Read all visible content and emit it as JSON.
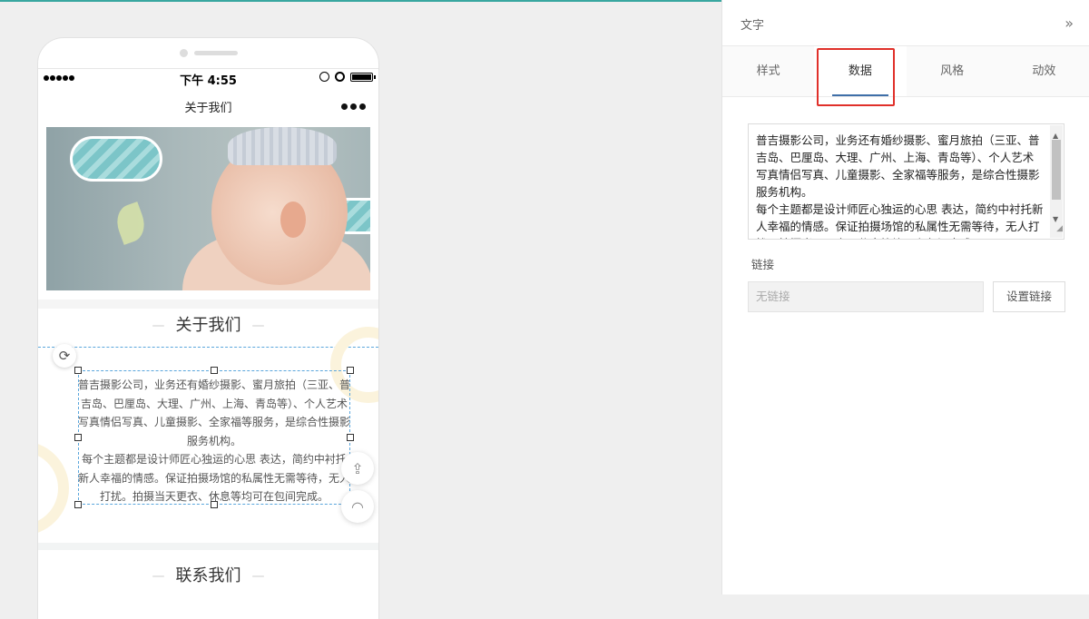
{
  "phone": {
    "status": {
      "time": "下午 4:55"
    },
    "navbar": {
      "title": "关于我们"
    },
    "section1": {
      "heading": "关于我们",
      "dash": "—"
    },
    "about_text": "普吉摄影公司，业务还有婚纱摄影、蜜月旅拍（三亚、普吉岛、巴厘岛、大理、广州、上海、青岛等）、个人艺术写真情侣写真、儿童摄影、全家福等服务，是综合性摄影服务机构。\n每个主题都是设计师匠心独运的心思 表达，简约中衬托新人幸福的情感。保证拍摄场馆的私属性无需等待，无人打扰。拍摄当天更衣、休息等均可在包间完成。",
    "section2": {
      "heading": "联系我们"
    }
  },
  "panel": {
    "title": "文字",
    "tabs": [
      "样式",
      "数据",
      "风格",
      "动效"
    ],
    "active_tab": "数据",
    "textarea_value": "普吉摄影公司，业务还有婚纱摄影、蜜月旅拍（三亚、普吉岛、巴厘岛、大理、广州、上海、青岛等）、个人艺术写真情侣写真、儿童摄影、全家福等服务，是综合性摄影服务机构。\n每个主题都是设计师匠心独运的心思 表达，简约中衬托新人幸福的情感。保证拍摄场馆的私属性无需等待，无人打扰。拍摄当天更衣、休息等均可在包间完成。",
    "link": {
      "label": "链接",
      "value": "无链接",
      "button": "设置链接"
    }
  },
  "colors": {
    "accent": "#3f6fa8",
    "highlight": "#e0302a",
    "selection": "#5aa6dc",
    "top_bar": "#39a7a0"
  },
  "icons": [
    "collapse-icon",
    "more-icon",
    "rotate-icon",
    "share-icon",
    "headset-icon",
    "lock-icon",
    "alarm-icon",
    "battery-icon"
  ]
}
